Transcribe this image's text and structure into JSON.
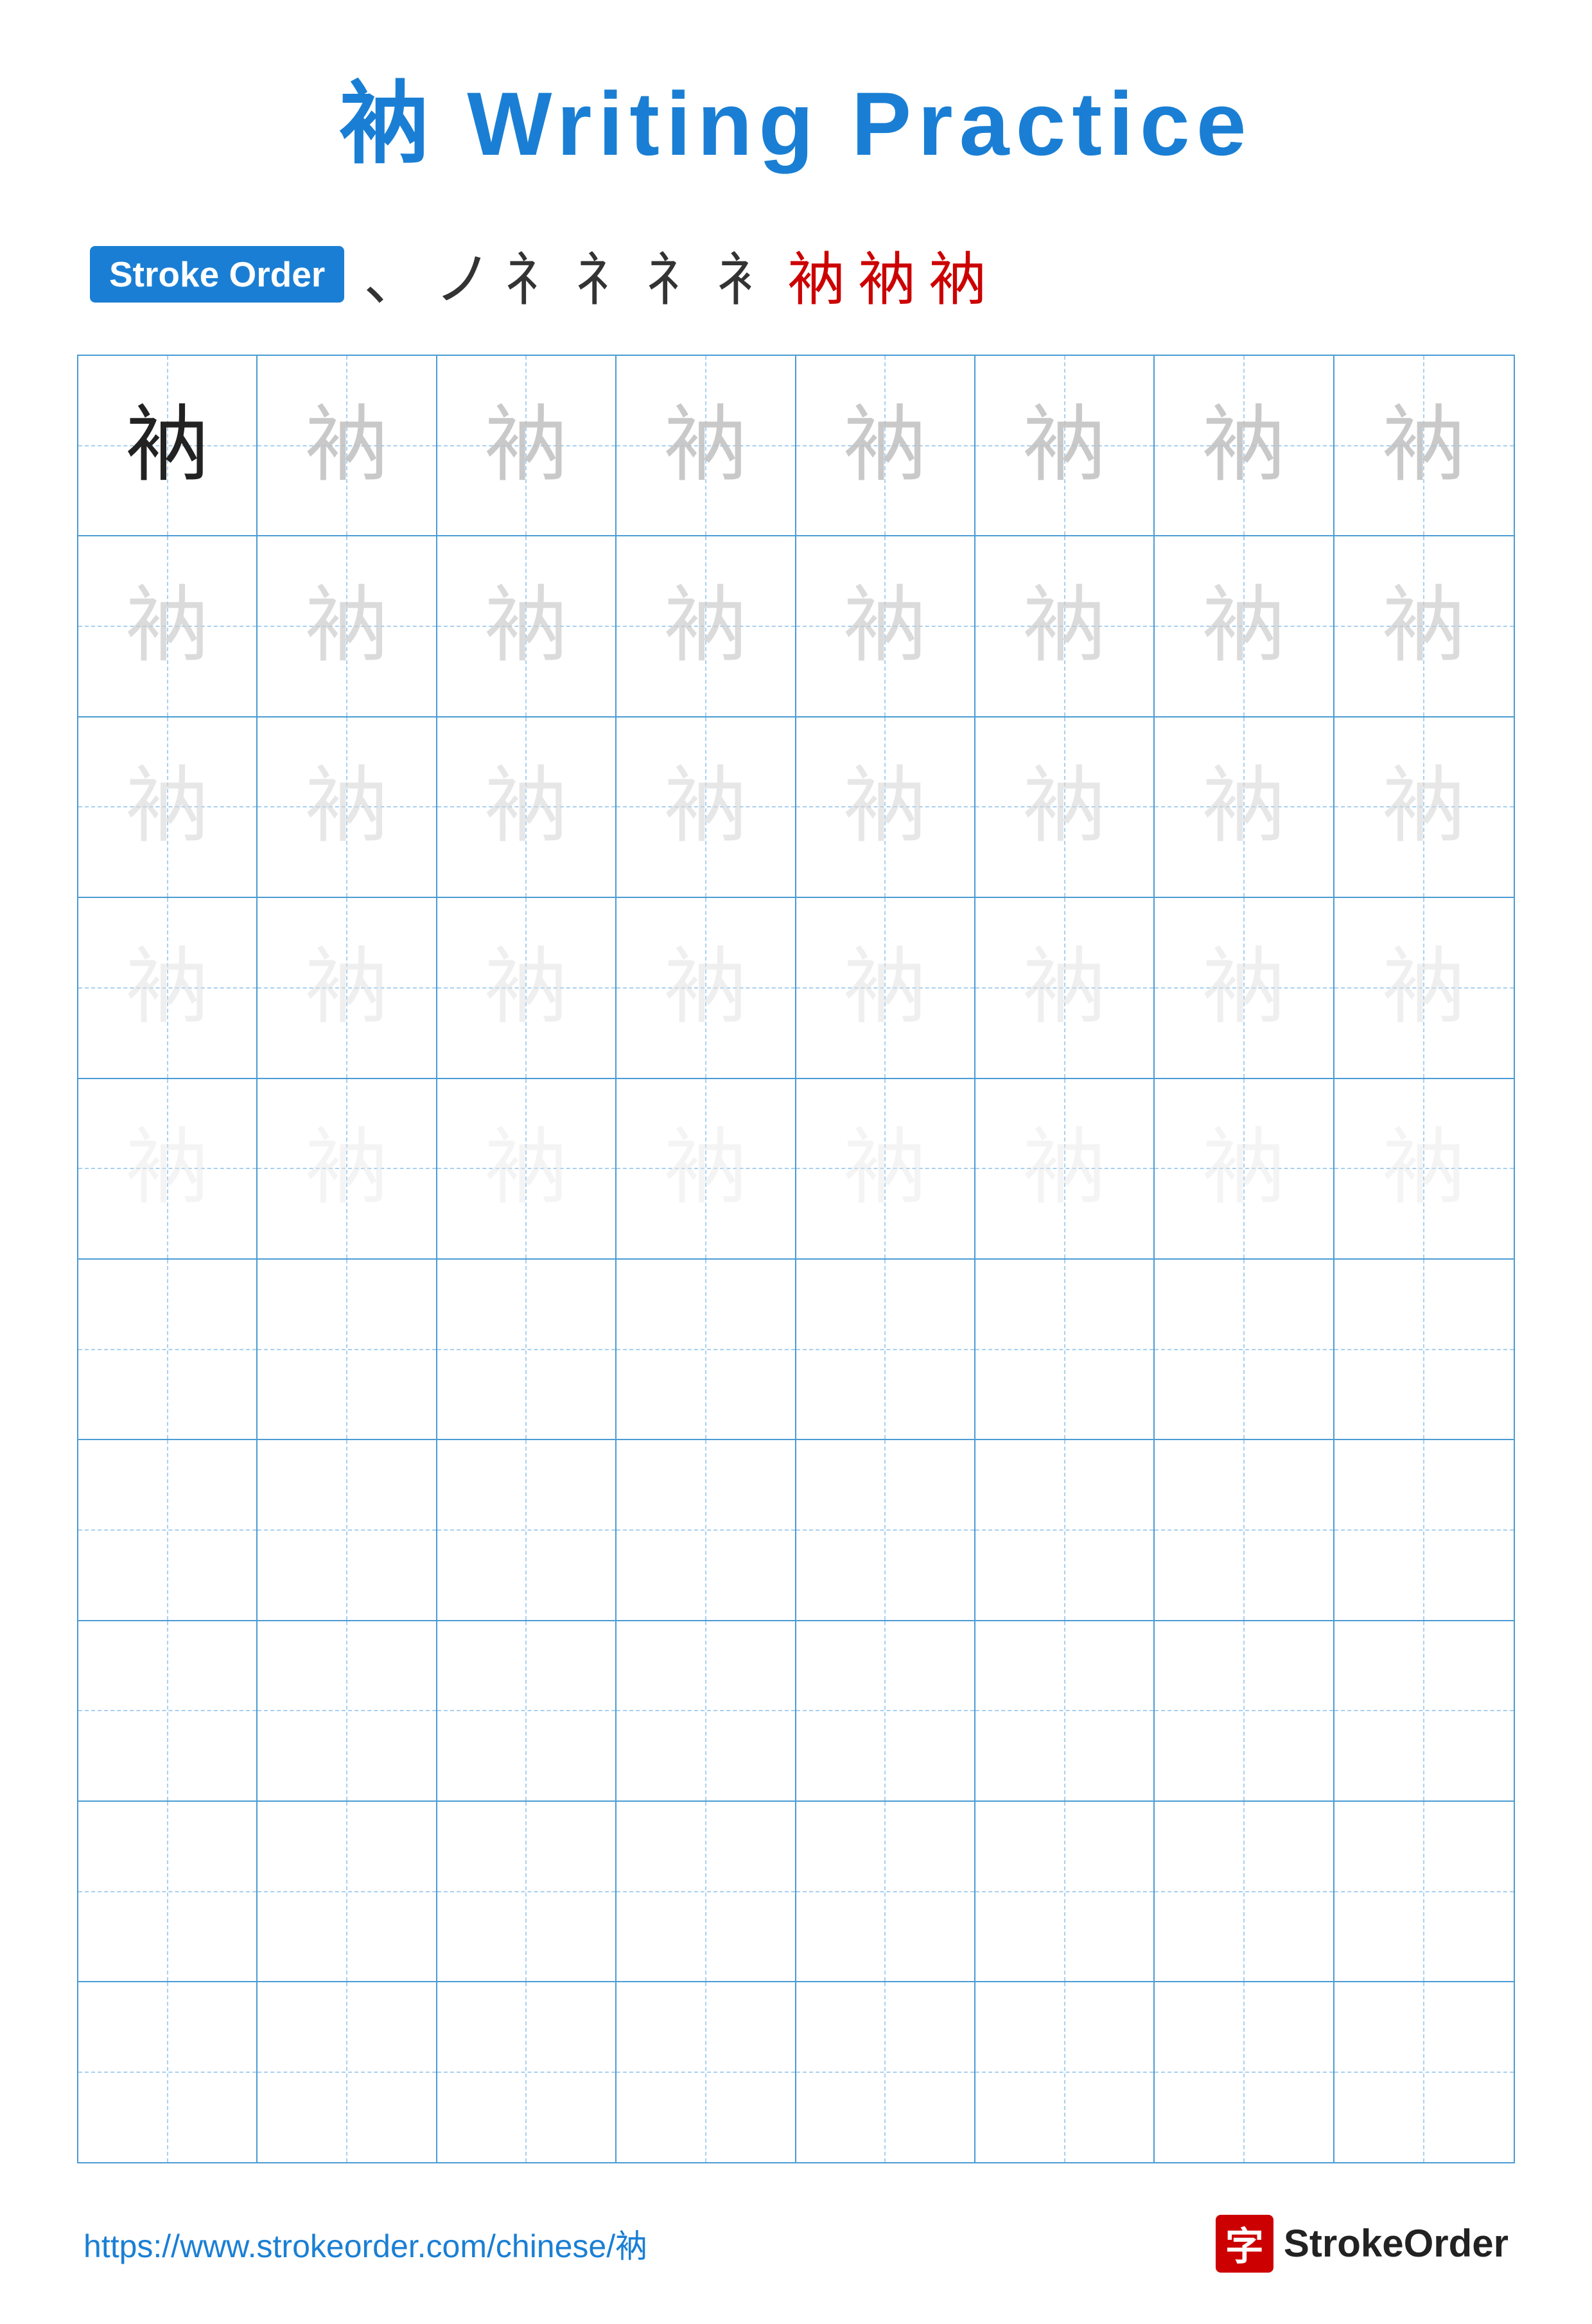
{
  "title": {
    "character": "衲",
    "text": " Writing Practice",
    "full": "衲 Writing Practice"
  },
  "stroke_order": {
    "badge_label": "Stroke Order",
    "strokes": [
      "、",
      "ノ",
      "礻",
      "礻",
      "礻",
      "衤",
      "衲",
      "衲",
      "衲"
    ],
    "stroke_colors": [
      "dark",
      "dark",
      "dark",
      "dark",
      "dark",
      "dark",
      "red",
      "red",
      "red"
    ]
  },
  "grid": {
    "rows": 10,
    "cols": 8,
    "character": "衲",
    "practice_rows_with_char": 5,
    "empty_rows": 5
  },
  "footer": {
    "url": "https://www.strokeorder.com/chinese/衲",
    "logo_char": "字",
    "logo_name": "StrokeOrder"
  }
}
